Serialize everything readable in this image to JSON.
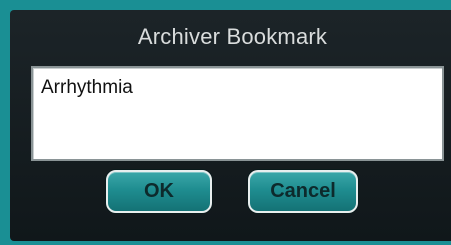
{
  "dialog": {
    "title": "Archiver Bookmark",
    "text_field": {
      "value": "Arrhythmia"
    },
    "buttons": {
      "ok_label": "OK",
      "cancel_label": "Cancel"
    }
  },
  "colors": {
    "background": "#1a8f94",
    "dialog_bg": "#161e21",
    "title_text": "#d9dcdc",
    "button_fill": "#1f8d90",
    "button_border": "#e8eeee",
    "button_text": "#0d2a2c"
  }
}
